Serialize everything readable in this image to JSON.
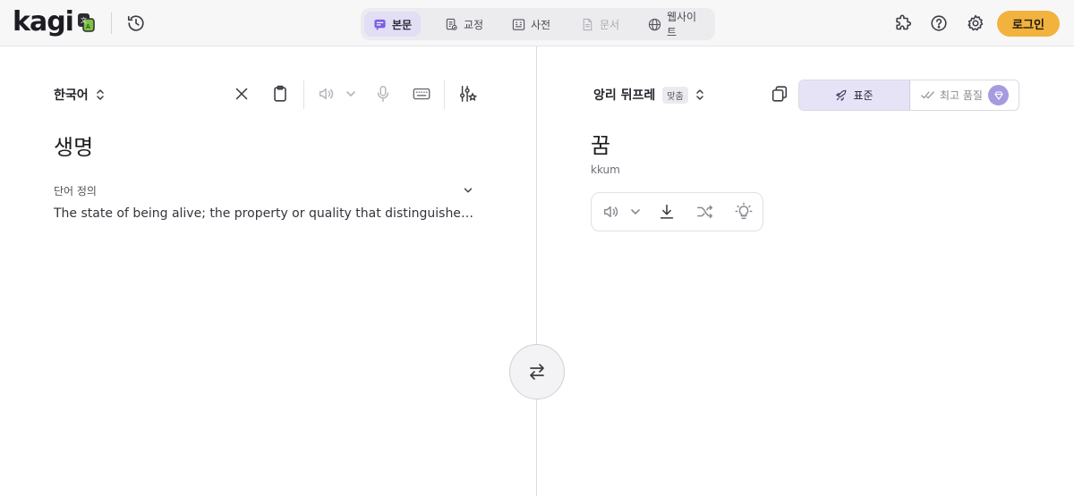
{
  "app": {
    "logo_text": "kagi",
    "accent_color": "#f2b23e",
    "active_mode_color": "#e2def5"
  },
  "modes": [
    {
      "label": "본문",
      "icon": "chat-bubble-icon",
      "state": "active"
    },
    {
      "label": "교정",
      "icon": "proofread-icon",
      "state": "normal"
    },
    {
      "label": "사전",
      "icon": "dictionary-icon",
      "state": "normal"
    },
    {
      "label": "문서",
      "icon": "document-icon",
      "state": "disabled"
    },
    {
      "label": "웹사이트",
      "icon": "globe-icon",
      "state": "normal"
    }
  ],
  "header_actions": {
    "login_label": "로그인",
    "icons": [
      "extension-icon",
      "help-icon",
      "settings-icon"
    ]
  },
  "source": {
    "language": "한국어",
    "text": "생명",
    "section_label": "단어 정의",
    "definition": "The state of being alive; the property or quality that distinguishes living…",
    "toolbar_icons": [
      "clear-icon",
      "clipboard-icon",
      "speaker-icon",
      "chevron-down-icon",
      "microphone-icon",
      "keyboard-icon",
      "adjust-icon"
    ]
  },
  "target": {
    "language": "앙리 뒤프레",
    "language_tag": "맞춤",
    "text": "꿈",
    "romanization": "kkum",
    "quality_standard": "표준",
    "quality_best": "최고 품질",
    "action_icons": [
      "speaker-icon",
      "chevron-down-icon",
      "download-icon",
      "shuffle-icon",
      "lightbulb-icon"
    ]
  }
}
